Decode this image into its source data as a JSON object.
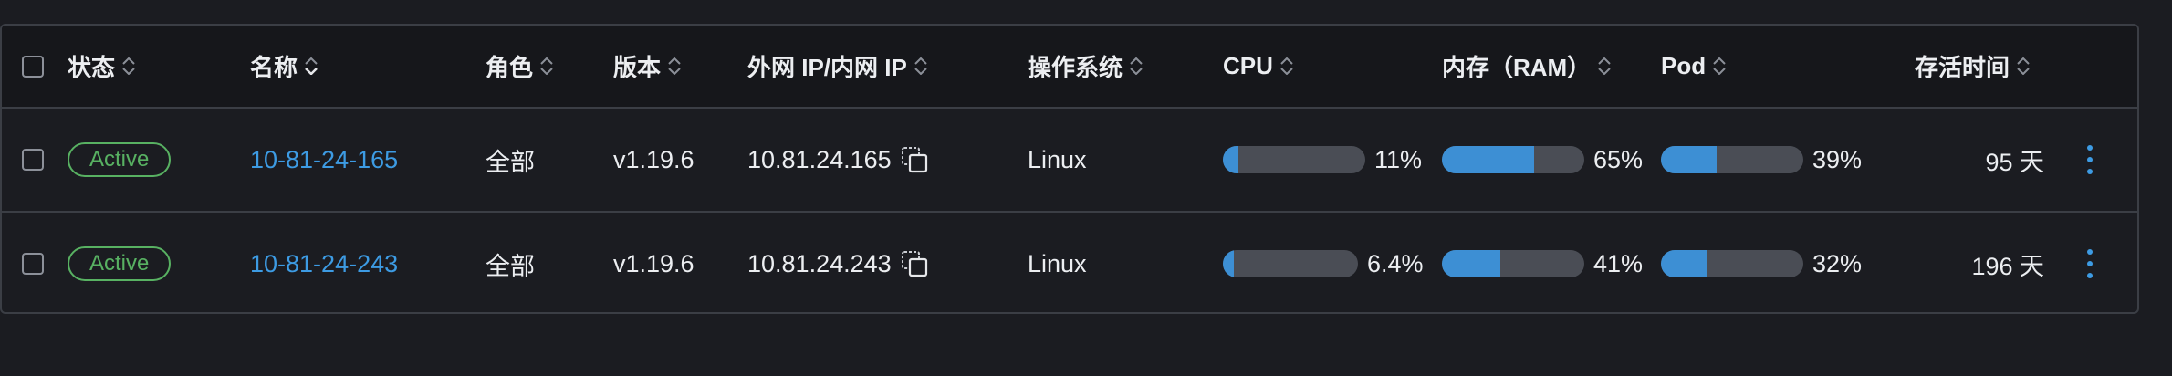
{
  "colors": {
    "accent": "#3d9be3",
    "status_active": "#58b162",
    "bar_track": "#4a4d55",
    "bar_fill": "#3d8fd4"
  },
  "header": {
    "status": "状态",
    "name": "名称",
    "role": "角色",
    "version": "版本",
    "ip": "外网 IP/内网 IP",
    "os": "操作系统",
    "cpu": "CPU",
    "ram": "内存（RAM）",
    "pod": "Pod",
    "uptime": "存活时间"
  },
  "rows": [
    {
      "status": "Active",
      "name": "10-81-24-165",
      "role": "全部",
      "version": "v1.19.6",
      "ip": "10.81.24.165",
      "os": "Linux",
      "cpu_label": "11%",
      "cpu_pct": 11,
      "ram_label": "65%",
      "ram_pct": 65,
      "pod_label": "39%",
      "pod_pct": 39,
      "uptime": "95 天"
    },
    {
      "status": "Active",
      "name": "10-81-24-243",
      "role": "全部",
      "version": "v1.19.6",
      "ip": "10.81.24.243",
      "os": "Linux",
      "cpu_label": "6.4%",
      "cpu_pct": 6.4,
      "ram_label": "41%",
      "ram_pct": 41,
      "pod_label": "32%",
      "pod_pct": 32,
      "uptime": "196 天"
    }
  ]
}
